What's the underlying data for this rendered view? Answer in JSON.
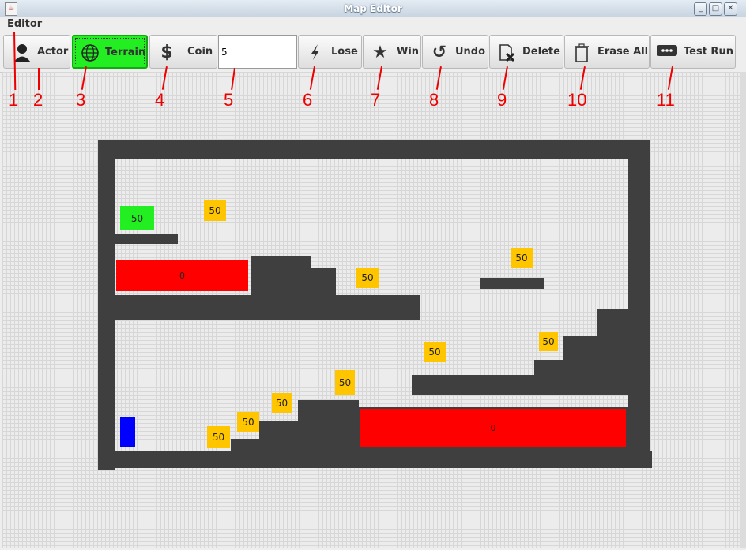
{
  "window": {
    "title": "Map Editor",
    "app_icon": "java-icon"
  },
  "menu": {
    "items": [
      "Editor"
    ]
  },
  "toolbar": {
    "actor": {
      "label": "Actor",
      "icon": "person-icon"
    },
    "terrain": {
      "label": "Terrain",
      "icon": "globe-icon",
      "active": true
    },
    "coin": {
      "label": "Coin",
      "icon": "dollar-icon"
    },
    "value_input": "5",
    "lose": {
      "label": "Lose",
      "icon": "lightning-icon"
    },
    "win": {
      "label": "Win",
      "icon": "star-icon"
    },
    "undo": {
      "label": "Undo",
      "icon": "undo-icon"
    },
    "delete": {
      "label": "Delete",
      "icon": "delete-file-icon"
    },
    "erase_all": {
      "label": "Erase All",
      "icon": "trash-icon"
    },
    "test_run": {
      "label": "Test Run",
      "icon": "dots-icon"
    }
  },
  "annotations": [
    "1",
    "2",
    "3",
    "4",
    "5",
    "6",
    "7",
    "8",
    "9",
    "10",
    "11"
  ],
  "map": {
    "coin_value": "50",
    "lava_value": "0",
    "goal_value": "50",
    "colors": {
      "terrain": "#3f3f3f",
      "lava": "#ff0000",
      "coin": "#ffc600",
      "goal": "#22ee22",
      "actor": "#0000ff",
      "active_tool": "#22ee22"
    }
  }
}
